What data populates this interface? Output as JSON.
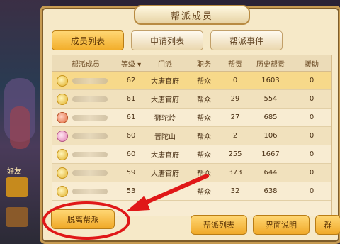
{
  "sidebar": {
    "label": "好友"
  },
  "panel": {
    "title": "帮派成员"
  },
  "tabs": [
    "成员列表",
    "申请列表",
    "帮派事件"
  ],
  "table": {
    "columns": [
      "帮派成员",
      "等级 ▾",
      "门派",
      "职务",
      "帮贡",
      "历史帮贡",
      "援助"
    ],
    "rows": [
      {
        "level": "62",
        "school": "大唐官府",
        "role": "帮众",
        "contrib": "0",
        "history": "1603",
        "aid": "0",
        "avatar": "gold"
      },
      {
        "level": "61",
        "school": "大唐官府",
        "role": "帮众",
        "contrib": "29",
        "history": "554",
        "aid": "0",
        "avatar": "gold"
      },
      {
        "level": "61",
        "school": "狮驼岭",
        "role": "帮众",
        "contrib": "27",
        "history": "685",
        "aid": "0",
        "avatar": "red"
      },
      {
        "level": "60",
        "school": "普陀山",
        "role": "帮众",
        "contrib": "2",
        "history": "106",
        "aid": "0",
        "avatar": "pink"
      },
      {
        "level": "60",
        "school": "大唐官府",
        "role": "帮众",
        "contrib": "255",
        "history": "1667",
        "aid": "0",
        "avatar": "gold"
      },
      {
        "level": "59",
        "school": "大唐官府",
        "role": "帮众",
        "contrib": "373",
        "history": "644",
        "aid": "0",
        "avatar": "gold"
      },
      {
        "level": "53",
        "school": "",
        "role": "帮众",
        "contrib": "32",
        "history": "638",
        "aid": "0",
        "avatar": "gold"
      }
    ]
  },
  "buttons": {
    "leave": "脱离帮派",
    "gang_list": "帮派列表",
    "ui_help": "界面说明",
    "more": "群"
  },
  "annotation": {
    "color": "#e01818"
  }
}
